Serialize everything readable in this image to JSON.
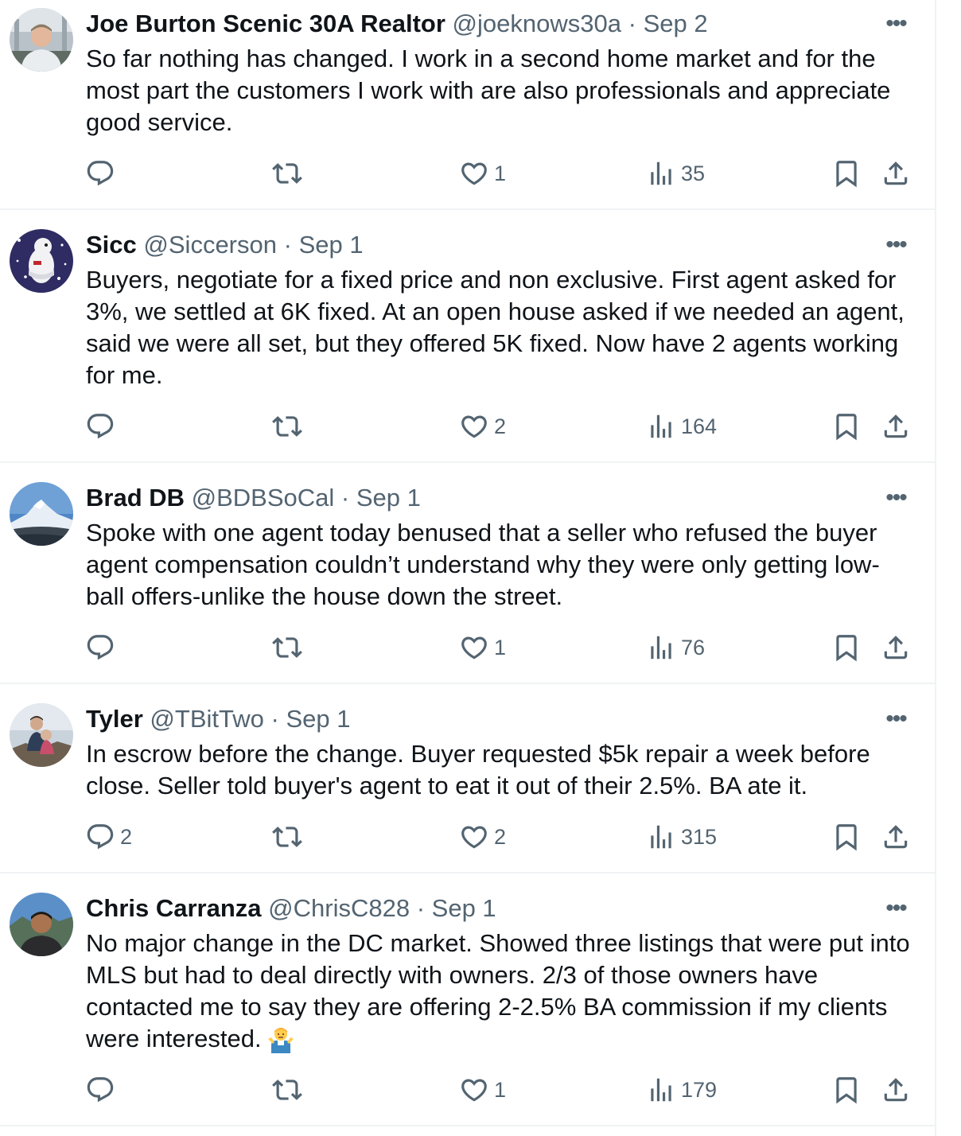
{
  "tweets": [
    {
      "name": "Joe Burton Scenic 30A Realtor",
      "handle": "@joeknows30a",
      "date": "Sep 2",
      "text_lines": [
        "So far nothing has changed. I work in a second home market and for the",
        "most part the customers I work with are also professionals and appreciate",
        "good service."
      ],
      "replies": "",
      "likes": "1",
      "views": "35"
    },
    {
      "name": "Sicc",
      "handle": "@Siccerson",
      "date": "Sep 1",
      "text_lines": [
        "Buyers, negotiate for a fixed price and non exclusive. First agent asked for",
        "3%, we settled at 6K fixed. At an open house asked if we needed an agent,",
        "said we were all set, but they offered 5K fixed. Now have 2 agents working",
        "for me."
      ],
      "replies": "",
      "likes": "2",
      "views": "164"
    },
    {
      "name": "Brad DB",
      "handle": "@BDBSoCal",
      "date": "Sep 1",
      "text_lines": [
        "Spoke with one agent today benused that a seller who refused the buyer",
        "agent compensation couldn’t understand why they were only getting low-",
        "ball offers-unlike the house down the street."
      ],
      "replies": "",
      "likes": "1",
      "views": "76"
    },
    {
      "name": "Tyler",
      "handle": "@TBitTwo",
      "date": "Sep 1",
      "text_lines": [
        "In escrow before the change. Buyer requested $5k repair a week before",
        "close. Seller told buyer's agent to eat it out of their 2.5%. BA ate it."
      ],
      "replies": "2",
      "likes": "2",
      "views": "315"
    },
    {
      "name": "Chris Carranza",
      "handle": "@ChrisC828",
      "date": "Sep 1",
      "text_lines": [
        "No major change in the DC market. Showed three listings that were put into",
        "MLS but had to deal directly with owners. 2/3 of those owners have",
        "contacted me to say they are offering 2-2.5% BA commission if my clients",
        "were interested."
      ],
      "emoji": "man-shrugging",
      "replies": "",
      "likes": "1",
      "views": "179"
    }
  ],
  "separator": "·",
  "more_label": "•••",
  "colors": {
    "text": "#0f1419",
    "secondary": "#536471",
    "divider": "#eff3f4"
  },
  "icons": [
    "reply-icon",
    "retweet-icon",
    "like-icon",
    "views-icon",
    "bookmark-icon",
    "share-icon",
    "more-icon"
  ]
}
